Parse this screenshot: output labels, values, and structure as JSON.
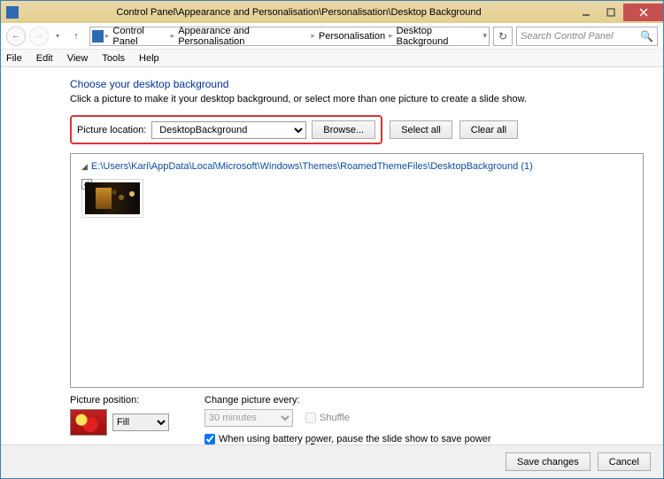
{
  "title": "Control Panel\\Appearance and Personalisation\\Personalisation\\Desktop Background",
  "breadcrumbs": [
    "Control Panel",
    "Appearance and Personalisation",
    "Personalisation",
    "Desktop Background"
  ],
  "search_placeholder": "Search Control Panel",
  "menu": {
    "file": "File",
    "edit": "Edit",
    "view": "View",
    "tools": "Tools",
    "help": "Help"
  },
  "heading": "Choose your desktop background",
  "subtext": "Click a picture to make it your desktop background, or select more than one picture to create a slide show.",
  "picture_location_label": "Picture location:",
  "picture_location_value": "DesktopBackground",
  "browse": "Browse...",
  "select_all": "Select all",
  "clear_all": "Clear all",
  "folder_path": "E:\\Users\\Kari\\AppData\\Local\\Microsoft\\Windows\\Themes\\RoamedThemeFiles\\DesktopBackground (1)",
  "picture_position_label": "Picture position:",
  "picture_position_value": "Fill",
  "change_every_label": "Change picture every:",
  "change_every_value": "30 minutes",
  "shuffle_label": "Shuffle",
  "battery_label": "When using battery power, pause the slide show to save power",
  "save_changes": "Save changes",
  "cancel": "Cancel"
}
